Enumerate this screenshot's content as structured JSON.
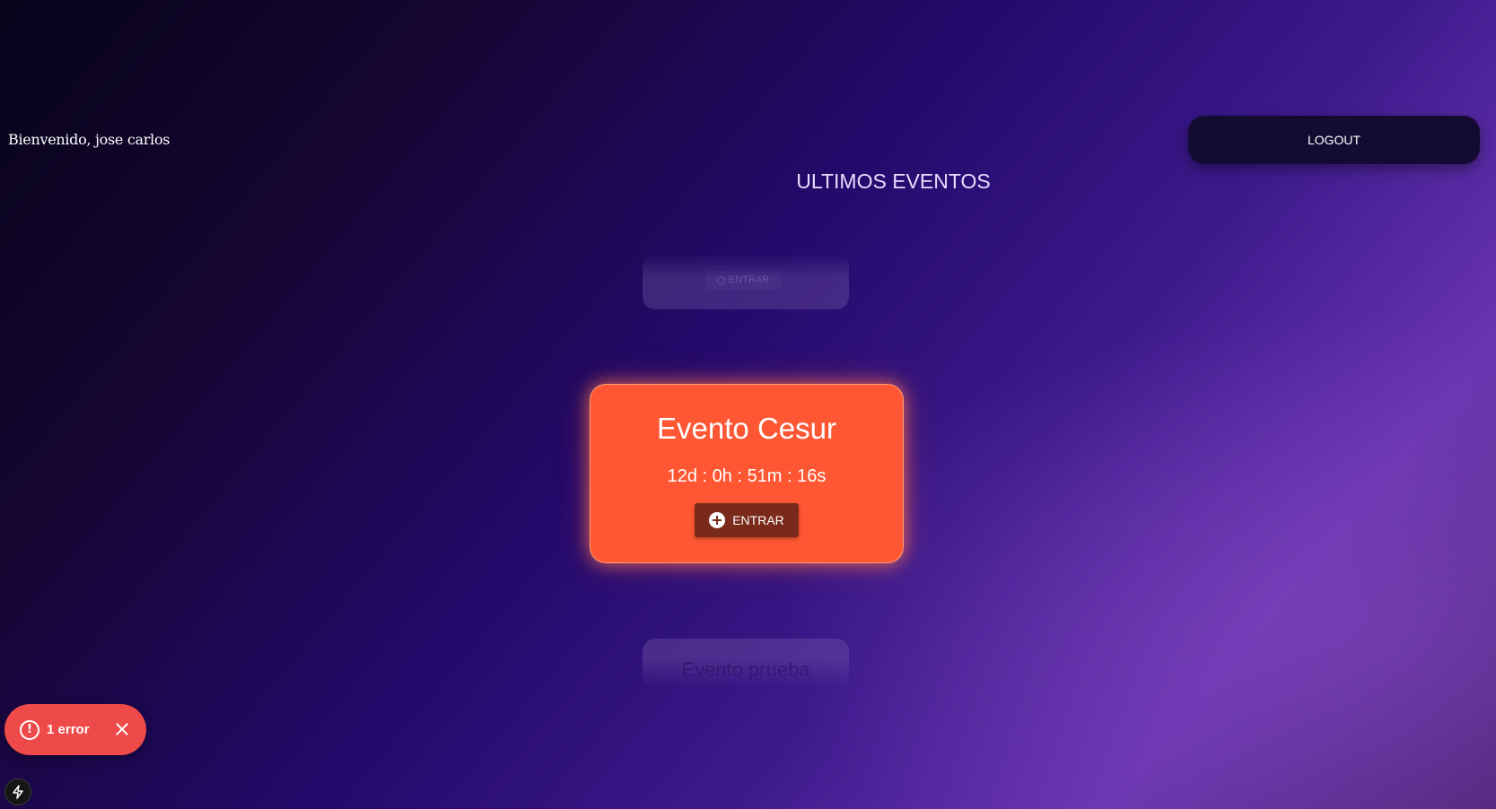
{
  "header": {
    "welcome_text": "Bienvenido, jose carlos",
    "logout_label": "LOGOUT"
  },
  "section": {
    "title": "ULTIMOS EVENTOS"
  },
  "events": {
    "previous": {
      "button_label": "ENTRAR"
    },
    "current": {
      "title": "Evento Cesur",
      "countdown": "12d : 0h : 51m : 16s",
      "enter_label": "ENTRAR"
    },
    "next": {
      "title": "Evento prueba"
    }
  },
  "error_toast": {
    "label": "1 error",
    "icon": "alert-circle-icon"
  },
  "dev_indicator": {
    "icon": "bolt-icon"
  },
  "colors": {
    "card_accent": "#ff5733",
    "enter_button": "#7a2a1a",
    "error_toast": "#ef4a4a",
    "logout_button": "#140b33"
  }
}
